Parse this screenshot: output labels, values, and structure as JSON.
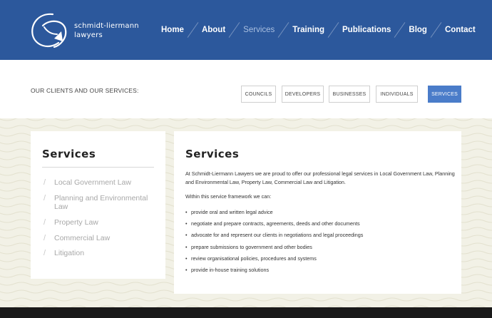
{
  "brand": {
    "line1": "schmidt-liermann",
    "line2": "lawyers"
  },
  "nav": [
    {
      "label": "Home",
      "active": false
    },
    {
      "label": "About",
      "active": false
    },
    {
      "label": "Services",
      "active": true
    },
    {
      "label": "Training",
      "active": false
    },
    {
      "label": "Publications",
      "active": false
    },
    {
      "label": "Blog",
      "active": false
    },
    {
      "label": "Contact",
      "active": false
    }
  ],
  "clients": {
    "label": "OUR CLIENTS AND OUR SERVICES:",
    "buttons": [
      "COUNCILS",
      "DEVELOPERS",
      "BUSINESSES",
      "INDIVIDUALS",
      "SERVICES"
    ]
  },
  "sidebar": {
    "title": "Services",
    "links": [
      "Local Government Law",
      "Planning and Environmental Law",
      "Property Law",
      "Commercial Law",
      "Litigation"
    ]
  },
  "main": {
    "title": "Services",
    "intro": "At Schmidt-Liermann Lawyers we are proud to offer our professional legal services in Local Government Law, Planning and Environmental Law, Property Law, Commercial Law and Litigation.",
    "sub": "Within this service framework we can:",
    "bullets": [
      "provide oral and written legal advice",
      "negotiate and prepare contracts, agreements, deeds and other documents",
      "advocate for and represent our clients in negotiations and legal proceedings",
      "prepare submissions to government and other bodies",
      "review organisational policies, procedures and systems",
      "provide  in-house training solutions"
    ]
  },
  "colors": {
    "header": "#2c589c",
    "active_button": "#4a7cc9",
    "pattern_bg": "#f2f1e6",
    "footer": "#1a1a1a"
  },
  "icons": [
    "logo-swoosh-icon",
    "slash-icon"
  ]
}
